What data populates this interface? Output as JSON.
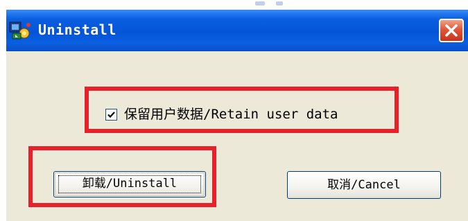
{
  "window": {
    "title": "Uninstall",
    "icon": "installer-app-icon",
    "close_icon": "close-icon"
  },
  "dialog": {
    "checkbox": {
      "label": "保留用户数据/Retain user data",
      "checked": true
    },
    "buttons": {
      "uninstall_label": "卸载/Uninstall",
      "cancel_label": "取消/Cancel"
    }
  },
  "colors": {
    "titlebar": "#0554d8",
    "window_background": "#ece9d8",
    "highlight_box": "#e8202a",
    "close_button": "#e2553a"
  }
}
